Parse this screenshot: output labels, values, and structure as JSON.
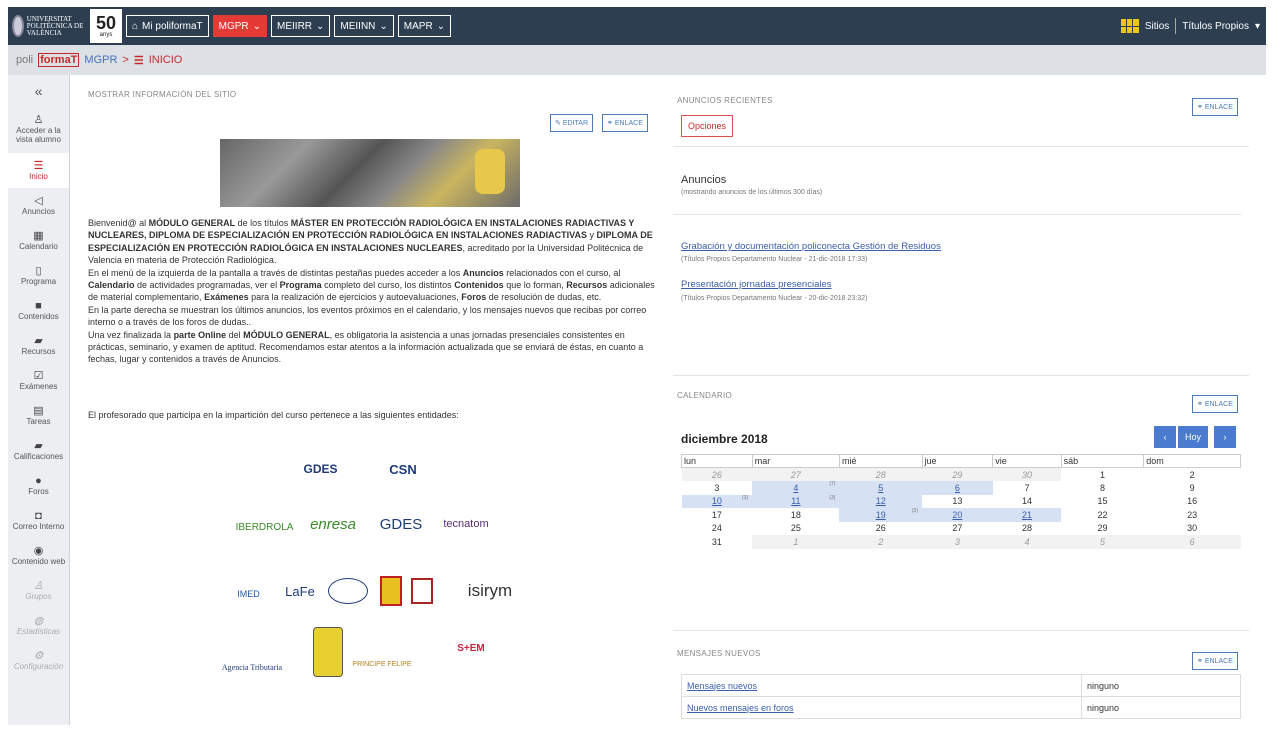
{
  "topbar": {
    "logo_text": "UNIVERSITAT POLITÈCNICA DE VALÈNCIA",
    "anniversary": "50",
    "anniversary_sub": "anys",
    "buttons": [
      {
        "label": "Mi poliformaT"
      },
      {
        "label": "MGPR"
      },
      {
        "label": "MEIIRR"
      },
      {
        "label": "MEIINN"
      },
      {
        "label": "MAPR"
      }
    ],
    "sitios": "Sitios",
    "titulos": "Títulos Propios"
  },
  "breadcrumb": {
    "poli": "poli",
    "formaT": "formaT",
    "site": "MGPR",
    "separator": ">",
    "page": "INICIO"
  },
  "sidebar": {
    "collapse": "«",
    "items": [
      {
        "label": "Acceder a la vista alumno",
        "icon": "user-icon"
      },
      {
        "label": "Inicio",
        "icon": "list-icon"
      },
      {
        "label": "Anuncios",
        "icon": "megaphone-icon"
      },
      {
        "label": "Calendario",
        "icon": "calendar-icon"
      },
      {
        "label": "Programa",
        "icon": "map-icon"
      },
      {
        "label": "Contenidos",
        "icon": "folder-icon"
      },
      {
        "label": "Recursos",
        "icon": "folder-open-icon"
      },
      {
        "label": "Exámenes",
        "icon": "check-icon"
      },
      {
        "label": "Tareas",
        "icon": "file-icon"
      },
      {
        "label": "Calificaciones",
        "icon": "book-icon"
      },
      {
        "label": "Foros",
        "icon": "chat-icon"
      },
      {
        "label": "Correo Interno",
        "icon": "inbox-icon"
      },
      {
        "label": "Contenido web",
        "icon": "globe-icon"
      },
      {
        "label": "Grupos",
        "icon": "group-icon"
      },
      {
        "label": "Estadísticas",
        "icon": "stats-icon"
      },
      {
        "label": "Configuración",
        "icon": "gear-icon"
      }
    ]
  },
  "site_info": {
    "title": "MOSTRAR INFORMACIÓN DEL SITIO",
    "edit": "EDITAR",
    "link": "ENLACE",
    "entities_text": "El profesorado que participa en la impartición del curso pertenece a las siguientes entidades:",
    "logos": [
      "GDES",
      "CSN",
      "IBERDROLA",
      "enresa",
      "GDES",
      "tecnatom",
      "IMED",
      "LaFe",
      "isirym",
      "Agencia Tributaria",
      "PRINCIPE FELIPE",
      "S+EM"
    ]
  },
  "announcements": {
    "title": "ANUNCIOS RECIENTES",
    "link": "ENLACE",
    "options": "Opciones",
    "heading": "Anuncios",
    "subheading": "(mostrando anuncios de los últimos 300 días)",
    "items": [
      {
        "title": "Grabación y documentación policonecta Gestión de Residuos",
        "meta": "(Títulos Propios Departamento Nuclear - 21-dic-2018 17:33)"
      },
      {
        "title": "Presentación jornadas presenciales",
        "meta": "(Títulos Propios Departamento Nuclear - 20-dic-2018 23:32)"
      }
    ]
  },
  "calendar": {
    "title": "CALENDARIO",
    "link": "ENLACE",
    "month": "diciembre 2018",
    "prev": "‹",
    "today": "Hoy",
    "next": "›",
    "days": [
      "lun",
      "mar",
      "mié",
      "jue",
      "vie",
      "sáb",
      "dom"
    ]
  },
  "messages": {
    "title": "MENSAJES NUEVOS",
    "link": "ENLACE",
    "rows": [
      {
        "label": "Mensajes nuevos",
        "value": "ninguno"
      },
      {
        "label": "Nuevos mensajes en foros",
        "value": "ninguno"
      }
    ]
  }
}
